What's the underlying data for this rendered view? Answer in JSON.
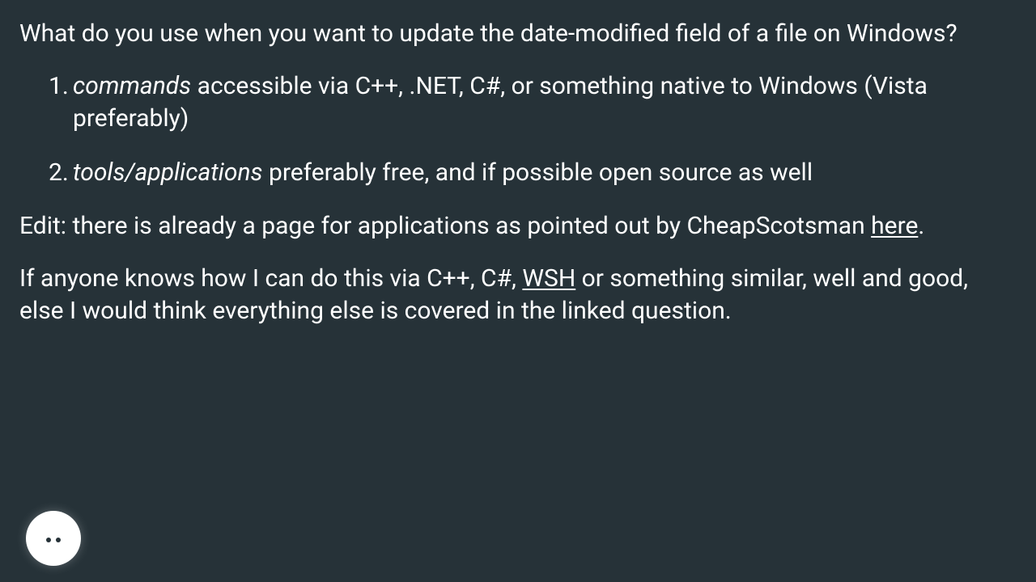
{
  "intro": "What do you use when you want to update the date-modified field of a file on Windows?",
  "list": {
    "item1": {
      "em": "commands",
      "rest": " accessible via C++, .NET, C#, or something native to Windows (Vista preferably)"
    },
    "item2": {
      "em": "tools/applications",
      "rest": " preferably free, and if possible open source as well"
    }
  },
  "edit": {
    "before_link": "Edit: there is already a page for applications as pointed out by CheapScotsman ",
    "link": "here",
    "after_link": "."
  },
  "final": {
    "before_link": "If anyone knows how I can do this via C++, C#, ",
    "link": "WSH",
    "after_link": " or something similar, well and good, else I would think everything else is covered in the linked question."
  }
}
